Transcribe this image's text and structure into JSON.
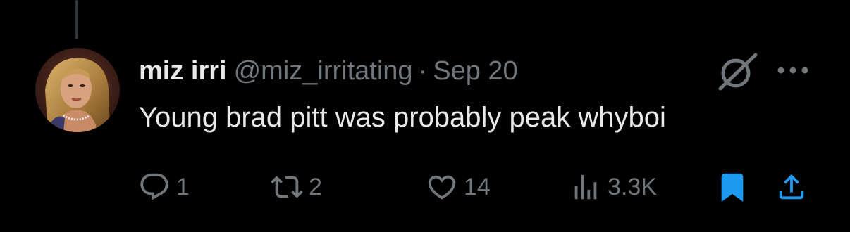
{
  "tweet": {
    "display_name": "miz irri",
    "handle": "@miz_irritating",
    "separator": "·",
    "timestamp": "Sep 20",
    "text": "Young brad pitt was probably peak whyboi"
  },
  "actions": {
    "replies": "1",
    "reposts": "2",
    "likes": "14",
    "views": "3.3K"
  },
  "icons": {
    "reply": "reply-icon",
    "repost": "repost-icon",
    "like": "heart-icon",
    "views": "views-chart-icon",
    "bookmark": "bookmark-icon",
    "share": "share-icon",
    "grok": "grok-icon",
    "more": "more-icon"
  },
  "colors": {
    "background": "#000000",
    "text_primary": "#e7e9ea",
    "text_secondary": "#71767b",
    "accent": "#1d9bf0"
  }
}
